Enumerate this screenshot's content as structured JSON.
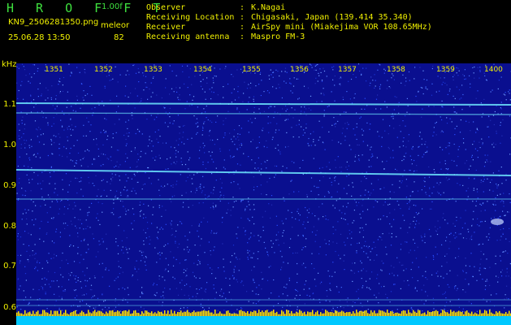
{
  "header": {
    "app_title": "H R O F F T",
    "version": "1.00f",
    "filename": "KN9_2506281350.png",
    "meleor_label": "meleor",
    "datetime": "25.06.28 13:50",
    "count": "82"
  },
  "info": [
    {
      "key": "Observer",
      "value": "K.Nagai"
    },
    {
      "key": "Receiving Location",
      "value": "Chigasaki, Japan (139.414 35.340)"
    },
    {
      "key": "Receiver",
      "value": "AirSpy mini (Miakejima VOR 108.65MHz)"
    },
    {
      "key": "Receiving antenna",
      "value": "Maspro FM-3"
    }
  ],
  "separator": ":",
  "axis": {
    "y_unit": "kHz",
    "y_ticks": [
      "1.1",
      "1.0",
      "0.9",
      "0.8",
      "0.7",
      "0.6"
    ],
    "x_ticks": [
      "1351",
      "1352",
      "1353",
      "1354",
      "1355",
      "1356",
      "1357",
      "1358",
      "1359",
      "1400"
    ]
  },
  "colors": {
    "background": "#0a0f8f",
    "label": "#f0f000",
    "title": "#3ee03e",
    "trace": "#6ee8ff",
    "floor": "#00c8ff"
  }
}
